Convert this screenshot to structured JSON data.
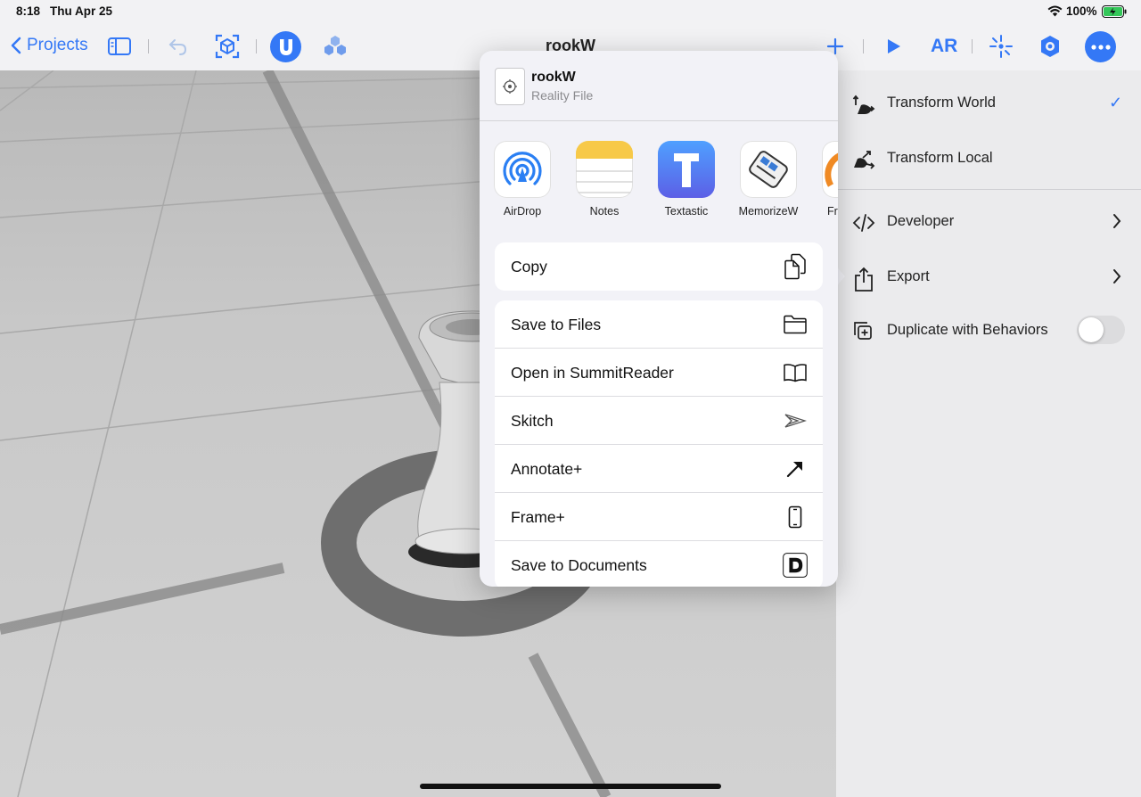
{
  "status_bar": {
    "time": "8:18",
    "date": "Thu Apr 25",
    "battery": "100%"
  },
  "toolbar": {
    "back_label": "Projects",
    "document_title": "rookW",
    "ar_label": "AR",
    "icons": [
      "chevron-left-icon",
      "sidebar-icon",
      "undo-icon",
      "scan-icon",
      "snap-magnet-icon",
      "library-icon",
      "add-icon",
      "play-icon",
      "ar-button",
      "transform-icon",
      "settings-icon",
      "more-icon"
    ],
    "accent_color": "#3478f6"
  },
  "share_sheet": {
    "file_name": "rookW",
    "file_type": "Reality File",
    "apps": [
      {
        "label": "AirDrop",
        "icon": "airdrop-icon"
      },
      {
        "label": "Notes",
        "icon": "notes-icon"
      },
      {
        "label": "Textastic",
        "icon": "textastic-icon"
      },
      {
        "label": "MemorizeW",
        "icon": "memorizew-icon"
      },
      {
        "label": "Fr",
        "icon": "partial-app-icon"
      }
    ],
    "copy_action": {
      "label": "Copy",
      "icon": "copy-icon"
    },
    "actions": [
      {
        "label": "Save to Files",
        "icon": "folder-icon"
      },
      {
        "label": "Open in SummitReader",
        "icon": "book-icon"
      },
      {
        "label": "Skitch",
        "icon": "skitch-icon"
      },
      {
        "label": "Annotate+",
        "icon": "arrow-icon"
      },
      {
        "label": "Frame+",
        "icon": "phone-icon"
      },
      {
        "label": "Save to Documents",
        "icon": "documents-icon"
      }
    ]
  },
  "menu": {
    "items": [
      {
        "label": "Transform World",
        "icon": "transform-world-icon",
        "checked": true,
        "check": "✓"
      },
      {
        "label": "Transform Local",
        "icon": "transform-local-icon"
      },
      {
        "label": "Developer",
        "icon": "code-icon",
        "has_submenu": true
      },
      {
        "label": "Export",
        "icon": "share-icon",
        "has_submenu": true
      },
      {
        "label": "Duplicate with Behaviors",
        "icon": "duplicate-icon",
        "toggle": false
      }
    ]
  }
}
